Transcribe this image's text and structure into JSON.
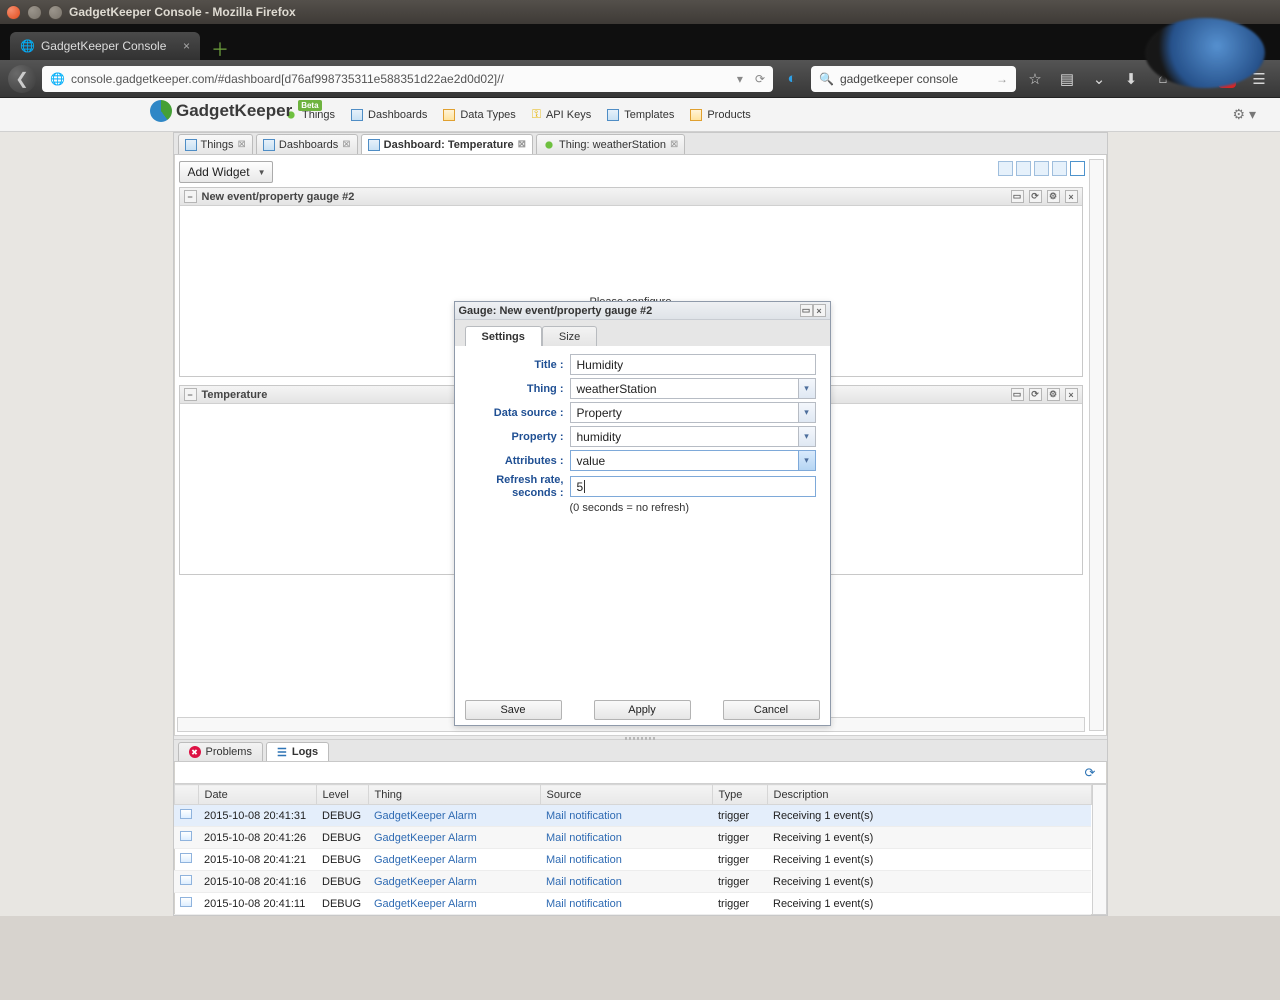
{
  "window": {
    "title": "GadgetKeeper Console - Mozilla Firefox"
  },
  "browser": {
    "tab_title": "GadgetKeeper Console",
    "url": "console.gadgetkeeper.com/#dashboard[d76af998735311e588351d22ae2d0d02]//",
    "search": "gadgetkeeper console"
  },
  "nav": {
    "brand": "GadgetKeeper",
    "beta": "Beta",
    "items": [
      "Things",
      "Dashboards",
      "Data Types",
      "API Keys",
      "Templates",
      "Products"
    ]
  },
  "tabs": {
    "things": "Things",
    "dashboards": "Dashboards",
    "dashboard_temp": "Dashboard: Temperature",
    "thing_ws": "Thing: weatherStation"
  },
  "dash": {
    "add_widget": "Add Widget",
    "widget1_title": "New event/property gauge #2",
    "widget1_msg": "Please configure",
    "widget2_title": "Temperature"
  },
  "dialog": {
    "title": "Gauge: New event/property gauge #2",
    "tab_settings": "Settings",
    "tab_size": "Size",
    "labels": {
      "title": "Title :",
      "thing": "Thing :",
      "data_source": "Data source :",
      "property": "Property :",
      "attributes": "Attributes :",
      "refresh_l1": "Refresh rate,",
      "refresh_l2": "seconds :"
    },
    "values": {
      "title": "Humidity",
      "thing": "weatherStation",
      "data_source": "Property",
      "property": "humidity",
      "attributes": "value",
      "refresh": "5"
    },
    "hint": "(0 seconds = no refresh)",
    "buttons": {
      "save": "Save",
      "apply": "Apply",
      "cancel": "Cancel"
    }
  },
  "bottom": {
    "problems": "Problems",
    "logs": "Logs",
    "cols": {
      "date": "Date",
      "level": "Level",
      "thing": "Thing",
      "source": "Source",
      "type": "Type",
      "desc": "Description"
    },
    "rows": [
      {
        "date": "2015-10-08 20:41:31",
        "level": "DEBUG",
        "thing": "GadgetKeeper Alarm",
        "source": "Mail notification",
        "type": "trigger",
        "desc": "Receiving 1 event(s)"
      },
      {
        "date": "2015-10-08 20:41:26",
        "level": "DEBUG",
        "thing": "GadgetKeeper Alarm",
        "source": "Mail notification",
        "type": "trigger",
        "desc": "Receiving 1 event(s)"
      },
      {
        "date": "2015-10-08 20:41:21",
        "level": "DEBUG",
        "thing": "GadgetKeeper Alarm",
        "source": "Mail notification",
        "type": "trigger",
        "desc": "Receiving 1 event(s)"
      },
      {
        "date": "2015-10-08 20:41:16",
        "level": "DEBUG",
        "thing": "GadgetKeeper Alarm",
        "source": "Mail notification",
        "type": "trigger",
        "desc": "Receiving 1 event(s)"
      },
      {
        "date": "2015-10-08 20:41:11",
        "level": "DEBUG",
        "thing": "GadgetKeeper Alarm",
        "source": "Mail notification",
        "type": "trigger",
        "desc": "Receiving 1 event(s)"
      }
    ]
  }
}
